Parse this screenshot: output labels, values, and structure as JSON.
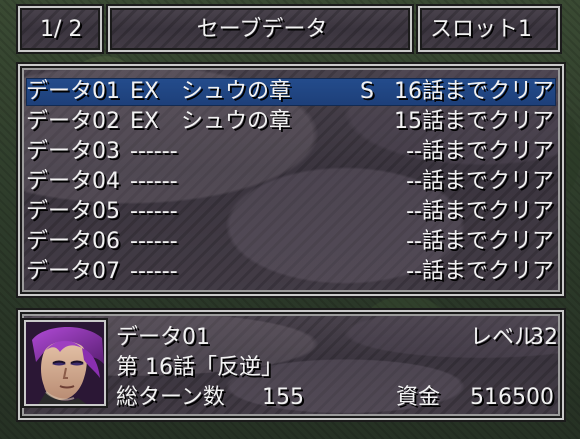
{
  "header": {
    "page": "1/ 2",
    "title": "セーブデータ",
    "slot": "スロット1"
  },
  "save_list": {
    "selected_index": 0,
    "rows": [
      {
        "name": "データ01",
        "chapter": "EX　シュウの章",
        "flag": "S",
        "progress": "16話までクリア"
      },
      {
        "name": "データ02",
        "chapter": "EX　シュウの章",
        "flag": "",
        "progress": "15話までクリア"
      },
      {
        "name": "データ03",
        "chapter": "------",
        "flag": "",
        "progress": "--話までクリア"
      },
      {
        "name": "データ04",
        "chapter": "------",
        "flag": "",
        "progress": "--話までクリア"
      },
      {
        "name": "データ05",
        "chapter": "------",
        "flag": "",
        "progress": "--話までクリア"
      },
      {
        "name": "データ06",
        "chapter": "------",
        "flag": "",
        "progress": "--話までクリア"
      },
      {
        "name": "データ07",
        "chapter": "------",
        "flag": "",
        "progress": "--話までクリア"
      }
    ]
  },
  "details": {
    "name": "データ01",
    "level_label": "レベル",
    "level_value": "32",
    "episode": "第 16話「反逆」",
    "turns_label": "総ターン数",
    "turns_value": "155",
    "funds_label": "資金",
    "funds_value": "516500"
  },
  "icons": {
    "portrait": "character-portrait-icon"
  }
}
